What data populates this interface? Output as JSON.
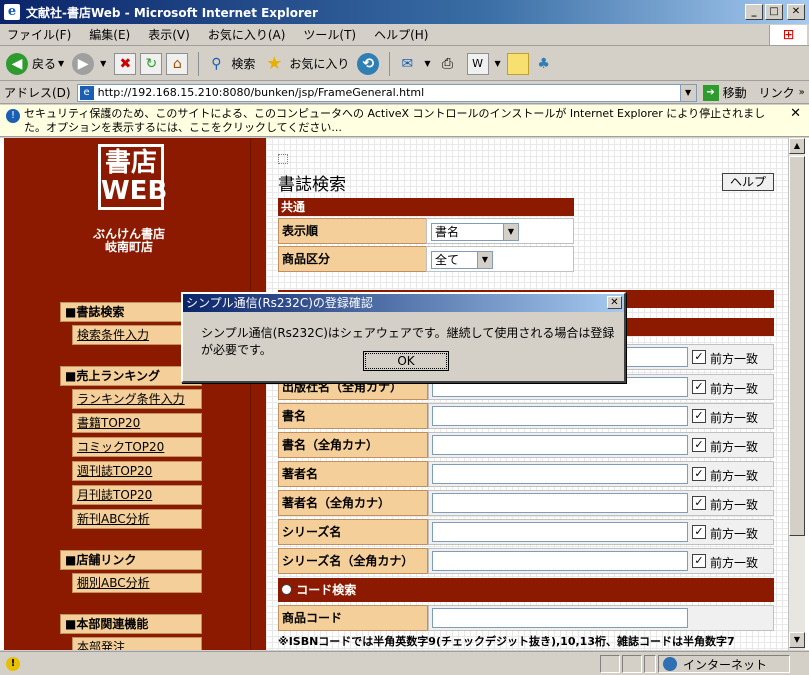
{
  "window": {
    "title": "文献社-書店Web - Microsoft Internet Explorer"
  },
  "menu": [
    "ファイル(F)",
    "編集(E)",
    "表示(V)",
    "お気に入り(A)",
    "ツール(T)",
    "ヘルプ(H)"
  ],
  "toolbar": {
    "back_label": "戻る",
    "search_label": "検索",
    "favorites_label": "お気に入り"
  },
  "address": {
    "label": "アドレス(D)",
    "url": "http://192.168.15.210:8080/bunken/jsp/FrameGeneral.html",
    "go_label": "移動",
    "links_label": "リンク"
  },
  "infobar": {
    "text": "セキュリティ保護のため、このサイトによる、このコンピュータへの ActiveX コントロールのインストールが Internet Explorer により停止されました。オプションを表示するには、ここをクリックしてください..."
  },
  "sidebar": {
    "logo_line1": "書店",
    "logo_line2": "WEB",
    "store_name_1": "ぶんけん書店",
    "store_name_2": "岐南町店",
    "sections": [
      {
        "title": "■書誌検索",
        "items": [
          "検索条件入力"
        ]
      },
      {
        "title": "■売上ランキング",
        "items": [
          "ランキング条件入力",
          "書籍TOP20",
          "コミックTOP20",
          "週刊誌TOP20",
          "月刊誌TOP20",
          "新刊ABC分析"
        ]
      },
      {
        "title": "■店舗リンク",
        "items": [
          "棚別ABC分析"
        ]
      },
      {
        "title": "■本部関連機能",
        "items": [
          "本部発注"
        ]
      }
    ]
  },
  "main": {
    "page_title": "書誌検索",
    "help_label": "ヘルプ",
    "common_band": "共通",
    "sort_label": "表示順",
    "sort_value": "書名",
    "product_label": "商品区分",
    "product_value": "全て",
    "fields": [
      {
        "label": "出版社名（全角カナ）"
      },
      {
        "label": "書名"
      },
      {
        "label": "書名（全角カナ）"
      },
      {
        "label": "著者名"
      },
      {
        "label": "著者名（全角カナ）"
      },
      {
        "label": "シリーズ名"
      },
      {
        "label": "シリーズ名（全角カナ）"
      }
    ],
    "prefix_label": "前方一致",
    "code_band": "コード検索",
    "code_label": "商品コード",
    "note": "※ISBNコードでは半角英数字9(チェックデジット抜き),10,13桁、雑誌コードは半角数字7"
  },
  "dialog": {
    "title": "シンプル通信(Rs232C)の登録確認",
    "message": "シンプル通信(Rs232C)はシェアウェアです。継続して使用される場合は登録が必要です。",
    "ok_label": "OK"
  },
  "status": {
    "zone_label": "インターネット"
  }
}
